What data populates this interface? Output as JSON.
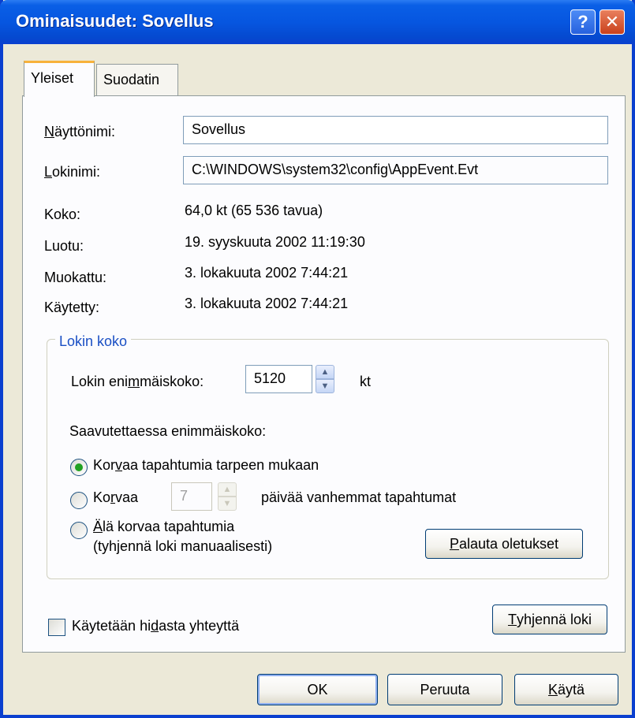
{
  "window": {
    "title": "Ominaisuudet: Sovellus",
    "help_glyph": "?",
    "close_glyph": "✕"
  },
  "tabs": [
    {
      "label": "Yleiset"
    },
    {
      "label": "Suodatin"
    }
  ],
  "general": {
    "display_name": {
      "label_mnemonic": "N",
      "label_rest": "äyttönimi:",
      "value": "Sovellus"
    },
    "log_name": {
      "label_mnemonic": "L",
      "label_rest": "okinimi:",
      "value": "C:\\WINDOWS\\system32\\config\\AppEvent.Evt"
    },
    "size": {
      "label": "Koko:",
      "value": "64,0 kt (65 536 tavua)"
    },
    "created": {
      "label": "Luotu:",
      "value": "19. syyskuuta 2002 11:19:30"
    },
    "modified": {
      "label": "Muokattu:",
      "value": "3. lokakuuta 2002 7:44:21"
    },
    "accessed": {
      "label": "Käytetty:",
      "value": "3. lokakuuta 2002 7:44:21"
    }
  },
  "log_size": {
    "group_title": "Lokin koko",
    "max_label_pre": "Lokin eni",
    "max_label_mnemonic": "m",
    "max_label_post": "mäiskoko:",
    "max_value": "5120",
    "unit": "kt",
    "when_reached": "Saavutettaessa enimmäiskoko:",
    "option1": {
      "pre": "Kor",
      "mnemonic": "v",
      "post": "aa tapahtumia tarpeen mukaan",
      "selected": true
    },
    "option2": {
      "pre": "Ko",
      "mnemonic": "r",
      "post": "vaa",
      "days": "7",
      "suffix": "päivää vanhemmat tapahtumat",
      "selected": false
    },
    "option3": {
      "mnemonic": "Ä",
      "post": "lä korvaa tapahtumia",
      "line2": "(tyhjennä loki manuaalisesti)",
      "selected": false
    },
    "restore_button": {
      "mnemonic": "P",
      "post": "alauta oletukset"
    }
  },
  "slow_link": {
    "pre": "Käytetään hi",
    "mnemonic": "d",
    "post": "asta yhteyttä",
    "checked": false
  },
  "clear_button": {
    "mnemonic": "T",
    "post": "yhjennä loki"
  },
  "buttons": {
    "ok": "OK",
    "cancel": "Peruuta",
    "apply_mnemonic": "K",
    "apply_post": "äytä"
  }
}
